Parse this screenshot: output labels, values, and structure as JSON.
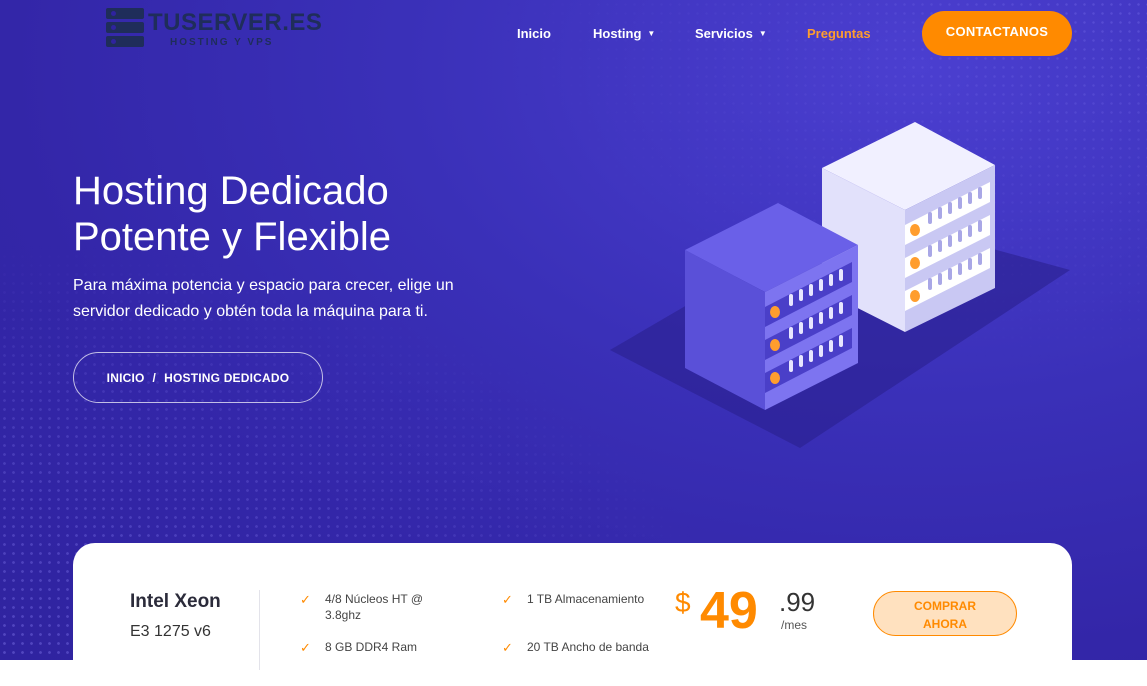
{
  "brand": {
    "title": "TUSERVER.ES",
    "subtitle": "HOSTING Y VPS",
    "icon": "server-stack-icon"
  },
  "nav": {
    "items": [
      {
        "label": "Inicio",
        "dropdown": false,
        "active": false
      },
      {
        "label": "Hosting",
        "dropdown": true,
        "active": false
      },
      {
        "label": "Servicios",
        "dropdown": true,
        "active": false
      },
      {
        "label": "Preguntas",
        "dropdown": false,
        "active": true
      }
    ],
    "cta_label": "CONTACTANOS"
  },
  "hero": {
    "title_line1": "Hosting Dedicado",
    "title_line2": "Potente y Flexible",
    "description": "Para máxima potencia y espacio para crecer, elige un servidor dedicado y obtén toda la máquina para ti.",
    "breadcrumb": {
      "home": "INICIO",
      "separator": "/",
      "current": "HOSTING DEDICADO"
    },
    "illustration": "isometric-servers-illustration"
  },
  "plan": {
    "cpu_name": "Intel Xeon",
    "cpu_model": "E3 1275 v6",
    "features": [
      "4/8 Núcleos HT @ 3.8ghz",
      "8 GB DDR4 Ram",
      "1 TB Almacenamiento",
      "20 TB Ancho de banda"
    ],
    "price": {
      "currency": "$",
      "integer": "49",
      "decimal": ".99",
      "period": "/mes"
    },
    "buy_line1": "COMPRAR",
    "buy_line2": "AHORA"
  },
  "colors": {
    "hero_bg": "#3326a8",
    "accent": "#ff8a00",
    "logo_dark": "#1f2d5a"
  }
}
